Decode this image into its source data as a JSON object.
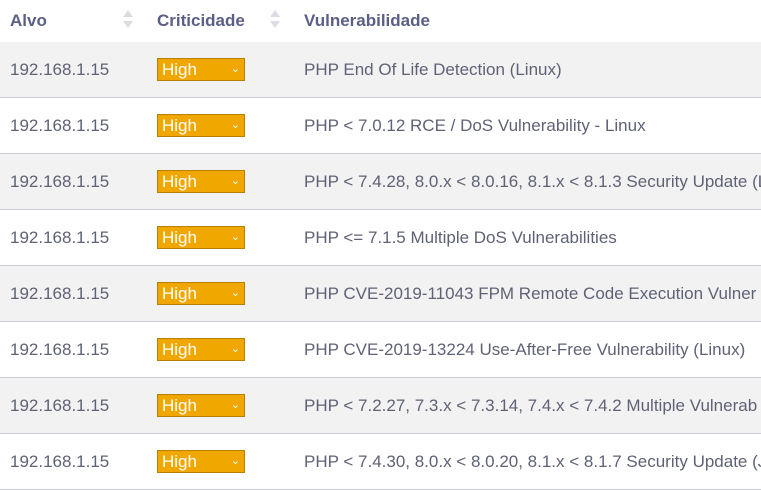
{
  "header": {
    "col_target": "Alvo",
    "col_criticality": "Criticidade",
    "col_vulnerability": "Vulnerabilidade"
  },
  "severity_color": "#f0a800",
  "rows": [
    {
      "target": "192.168.1.15",
      "criticality": "High",
      "vulnerability": "PHP End Of Life Detection (Linux)"
    },
    {
      "target": "192.168.1.15",
      "criticality": "High",
      "vulnerability": "PHP < 7.0.12 RCE / DoS Vulnerability - Linux"
    },
    {
      "target": "192.168.1.15",
      "criticality": "High",
      "vulnerability": "PHP < 7.4.28, 8.0.x < 8.0.16, 8.1.x < 8.1.3 Security Update (L"
    },
    {
      "target": "192.168.1.15",
      "criticality": "High",
      "vulnerability": "PHP <= 7.1.5 Multiple DoS Vulnerabilities"
    },
    {
      "target": "192.168.1.15",
      "criticality": "High",
      "vulnerability": "PHP CVE-2019-11043 FPM Remote Code Execution Vulner"
    },
    {
      "target": "192.168.1.15",
      "criticality": "High",
      "vulnerability": "PHP CVE-2019-13224 Use-After-Free Vulnerability (Linux)"
    },
    {
      "target": "192.168.1.15",
      "criticality": "High",
      "vulnerability": "PHP < 7.2.27, 7.3.x < 7.3.14, 7.4.x < 7.4.2 Multiple Vulnerab"
    },
    {
      "target": "192.168.1.15",
      "criticality": "High",
      "vulnerability": "PHP < 7.4.30, 8.0.x < 8.0.20, 8.1.x < 8.1.7 Security Update (J"
    }
  ]
}
